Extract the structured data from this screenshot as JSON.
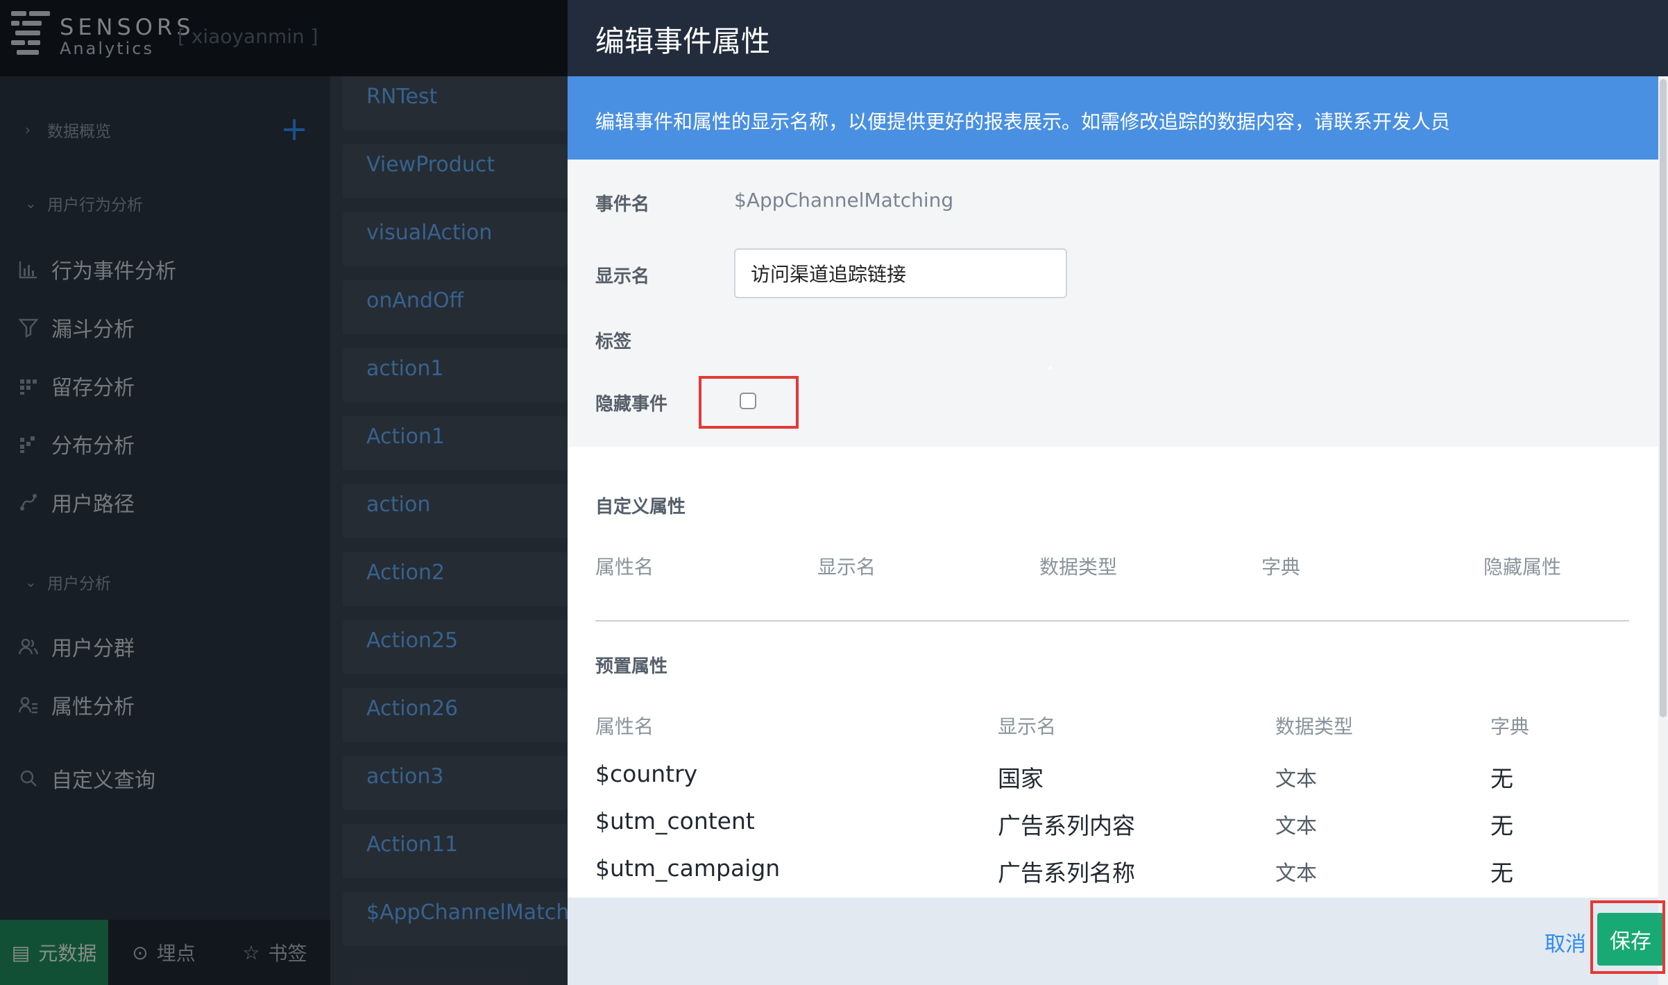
{
  "app": {
    "brand_line1": "SENSORS",
    "brand_line2": "Analytics",
    "user": "[ xiaoyanmin ]"
  },
  "sidebar": {
    "sections": [
      {
        "label": "数据概览"
      },
      {
        "label": "用户行为分析"
      },
      {
        "label": "用户分析"
      }
    ],
    "items": [
      {
        "label": "行为事件分析",
        "icon": "bar-chart-icon"
      },
      {
        "label": "漏斗分析",
        "icon": "funnel-icon"
      },
      {
        "label": "留存分析",
        "icon": "retention-icon"
      },
      {
        "label": "分布分析",
        "icon": "distribution-icon"
      },
      {
        "label": "用户路径",
        "icon": "path-icon"
      },
      {
        "label": "用户分群",
        "icon": "users-icon"
      },
      {
        "label": "属性分析",
        "icon": "user-attr-icon"
      },
      {
        "label": "自定义查询",
        "icon": "search-icon"
      }
    ],
    "bottom_tabs": [
      {
        "label": "元数据",
        "icon": "document-icon"
      },
      {
        "label": "埋点",
        "icon": "target-icon"
      },
      {
        "label": "书签",
        "icon": "star-icon"
      }
    ]
  },
  "event_list": [
    "RNTest",
    "ViewProduct",
    "visualAction",
    "onAndOff",
    "action1",
    "Action1",
    "action",
    "Action2",
    "Action25",
    "Action26",
    "action3",
    "Action11",
    "$AppChannelMatchin"
  ],
  "modal": {
    "title": "编辑事件属性",
    "notice": "编辑事件和属性的显示名称，以便提供更好的报表展示。如需修改追踪的数据内容，请联系开发人员",
    "form": {
      "event_name_label": "事件名",
      "event_name_value": "$AppChannelMatching",
      "display_name_label": "显示名",
      "display_name_value": "访问渠道追踪链接",
      "tag_label": "标签",
      "hide_event_label": "隐藏事件",
      "hide_event_checked": false
    },
    "custom_props": {
      "title": "自定义属性",
      "headers": [
        "属性名",
        "显示名",
        "数据类型",
        "字典",
        "隐藏属性"
      ]
    },
    "preset_props": {
      "title": "预置属性",
      "headers": [
        "属性名",
        "显示名",
        "数据类型",
        "字典"
      ],
      "rows": [
        [
          "$country",
          "国家",
          "文本",
          "无"
        ],
        [
          "$utm_content",
          "广告系列内容",
          "文本",
          "无"
        ],
        [
          "$utm_campaign",
          "广告系列名称",
          "文本",
          "无"
        ]
      ]
    },
    "footer": {
      "cancel_label": "取消",
      "save_label": "保存"
    }
  },
  "colors": {
    "notice_blue": "#4a90e2",
    "save_green": "#19a974",
    "highlight_red": "#e53935",
    "link_blue": "#2d8cf0"
  }
}
